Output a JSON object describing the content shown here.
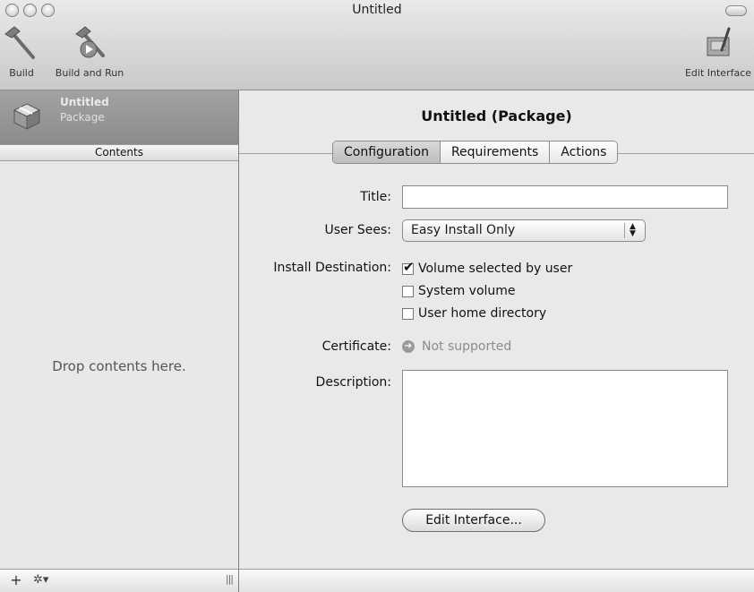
{
  "window": {
    "title": "Untitled"
  },
  "toolbar": {
    "build_label": "Build",
    "build_run_label": "Build and Run",
    "edit_interface_label": "Edit Interface"
  },
  "sidebar": {
    "package_name": "Untitled",
    "package_type": "Package",
    "contents_header": "Contents",
    "drop_hint": "Drop contents here.",
    "footer": {
      "add": "+",
      "gear": "✲▾",
      "grip": "|||"
    }
  },
  "main": {
    "heading": "Untitled (Package)",
    "tabs": [
      {
        "label": "Configuration",
        "active": true
      },
      {
        "label": "Requirements",
        "active": false
      },
      {
        "label": "Actions",
        "active": false
      }
    ],
    "fields": {
      "title_label": "Title:",
      "title_value": "",
      "user_sees_label": "User Sees:",
      "user_sees_value": "Easy Install Only",
      "install_destination_label": "Install Destination:",
      "destinations": [
        {
          "label": "Volume selected by user",
          "checked": true
        },
        {
          "label": "System volume",
          "checked": false
        },
        {
          "label": "User home directory",
          "checked": false
        }
      ],
      "certificate_label": "Certificate:",
      "certificate_value": "Not supported",
      "description_label": "Description:",
      "description_value": ""
    },
    "edit_interface_button": "Edit Interface..."
  },
  "icons": [
    "hammer-icon",
    "build-run-icon",
    "edit-interface-icon",
    "package-icon",
    "gear-icon",
    "arrow-circle-icon"
  ]
}
